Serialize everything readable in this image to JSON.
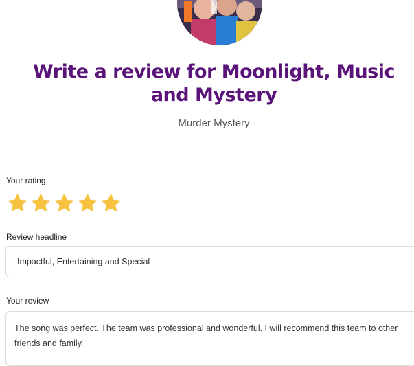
{
  "page": {
    "title": "Write a review for Moonlight, Music and Mystery",
    "category": "Murder Mystery"
  },
  "avatar": {
    "icon": "event-photo-avatar"
  },
  "rating": {
    "label": "Your rating",
    "value": 5,
    "max": 5,
    "star_color": "#f7c240"
  },
  "headline": {
    "label": "Review headline",
    "value": "Impactful, Entertaining and Special"
  },
  "review": {
    "label": "Your review",
    "value": "The song was perfect.  The team was professional and wonderful.  I will recommend this team to other friends and family."
  },
  "colors": {
    "title": "#5a1479",
    "star": "#f7c240",
    "border": "#dddddd"
  }
}
